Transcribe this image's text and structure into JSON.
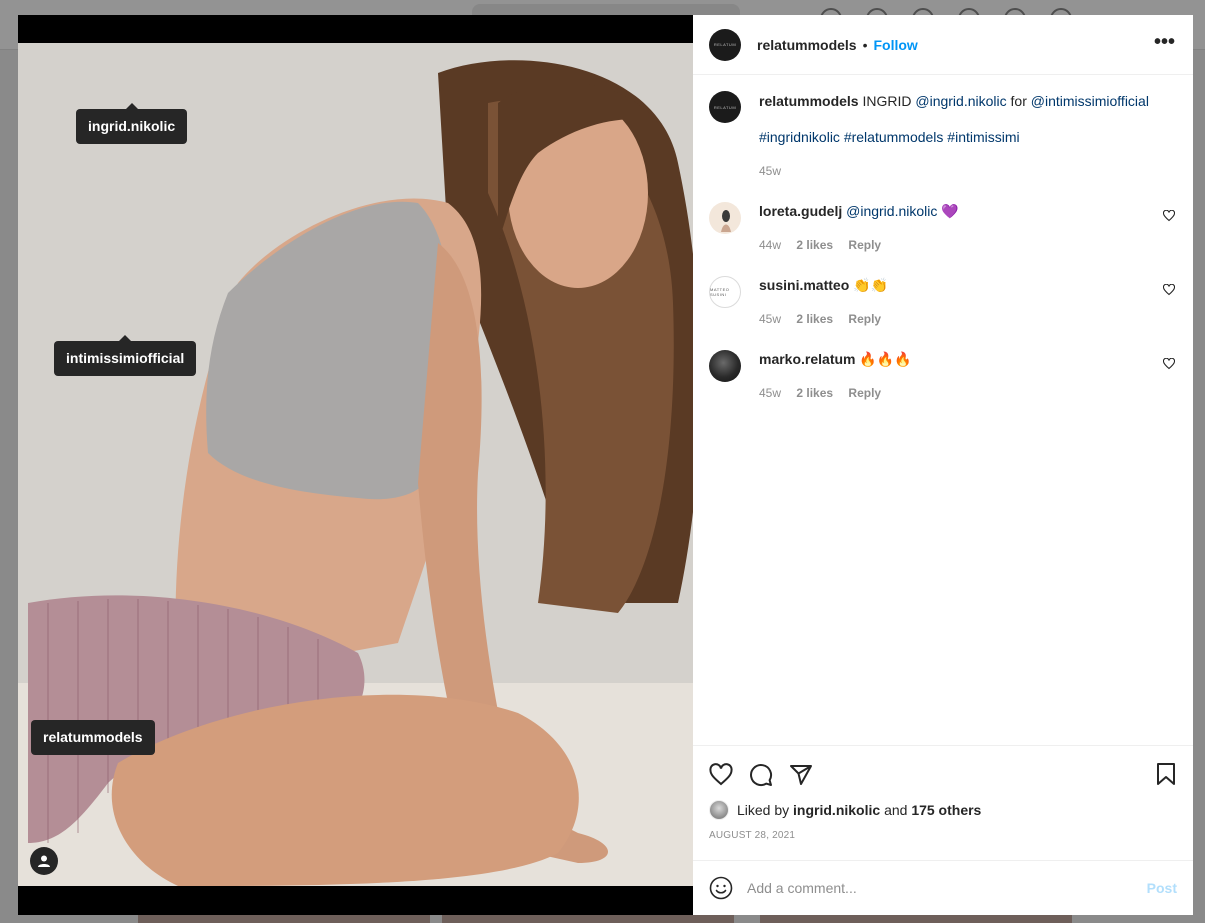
{
  "post": {
    "author": "relatummodels",
    "follow_label": "Follow",
    "more_label": "•••",
    "avatar_text": "RELATUM"
  },
  "photo_tags": [
    {
      "label": "ingrid.nikolic"
    },
    {
      "label": "intimissimiofficial"
    },
    {
      "label": "relatummodels"
    }
  ],
  "caption": {
    "user": "relatummodels",
    "text_before": "INGRID",
    "mention1": "@ingrid.nikolic",
    "text_mid": "for",
    "mention2": "@intimissimiofficial",
    "hashtags": "#ingridnikolic #relatummodels #intimissimi",
    "time": "45w"
  },
  "comments": [
    {
      "user": "loreta.gudelj",
      "mention": "@ingrid.nikolic",
      "emoji": "💜",
      "time": "44w",
      "likes": "2 likes",
      "reply": "Reply",
      "avatar": "light"
    },
    {
      "user": "susini.matteo",
      "mention": "",
      "emoji": "👏👏",
      "time": "45w",
      "likes": "2 likes",
      "reply": "Reply",
      "avatar": "white",
      "avatar_text": "MATTEO SUSINI"
    },
    {
      "user": "marko.relatum",
      "mention": "",
      "emoji": "🔥🔥🔥",
      "time": "45w",
      "likes": "2 likes",
      "reply": "Reply",
      "avatar": "photo-dark"
    }
  ],
  "likes": {
    "prefix": "Liked by",
    "user": "ingrid.nikolic",
    "and": "and",
    "others": "175 others"
  },
  "date": "AUGUST 28, 2021",
  "add_comment": {
    "placeholder": "Add a comment...",
    "post_label": "Post"
  },
  "icons": {
    "like": "heart-icon",
    "comment": "comment-icon",
    "share": "paper-plane-icon",
    "save": "bookmark-icon",
    "emoji": "smiley-icon",
    "user_tags": "person-icon"
  },
  "colors": {
    "link": "#00376b",
    "follow": "#0095f6",
    "muted": "#8e8e8e",
    "post_disabled": "#b2dffc"
  }
}
